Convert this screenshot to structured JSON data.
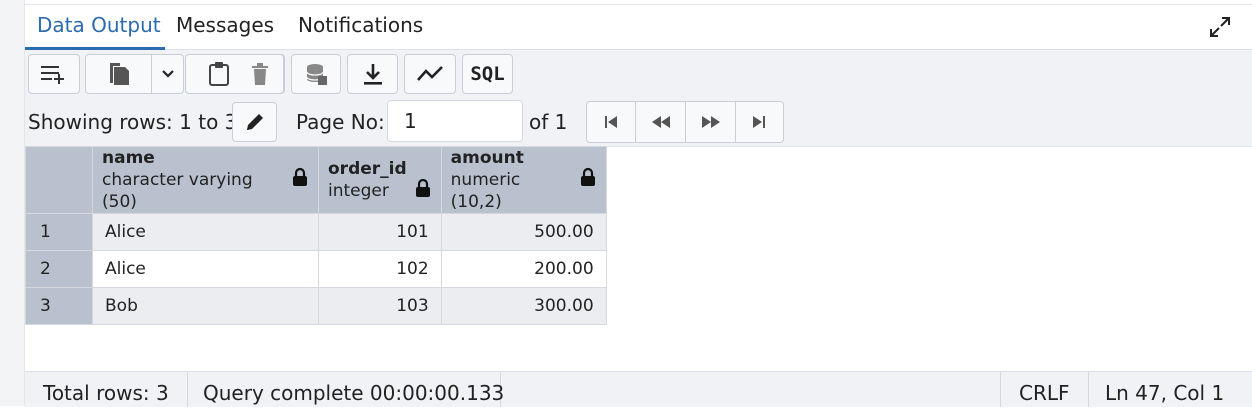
{
  "tabs": [
    {
      "label": "Data Output",
      "active": true
    },
    {
      "label": "Messages",
      "active": false
    },
    {
      "label": "Notifications",
      "active": false
    }
  ],
  "toolbar": {
    "buttons": [
      "add-row-icon",
      "copy-icon",
      "chevron-down-icon",
      "paste-icon",
      "chevron-down-icon",
      "delete-icon",
      "save-data-icon",
      "download-icon",
      "graph-icon"
    ],
    "sql_label": "SQL"
  },
  "pagination": {
    "showing_label": "Showing rows: 1 to 3",
    "page_label": "Page No:",
    "page_value": "1",
    "of_label": "of 1"
  },
  "grid": {
    "columns": [
      {
        "name": "name",
        "type": "character varying (50)"
      },
      {
        "name": "order_id",
        "type": "integer"
      },
      {
        "name": "amount",
        "type": "numeric (10,2)"
      }
    ],
    "rows": [
      {
        "num": "1",
        "name": "Alice",
        "order_id": "101",
        "amount": "500.00"
      },
      {
        "num": "2",
        "name": "Alice",
        "order_id": "102",
        "amount": "200.00"
      },
      {
        "num": "3",
        "name": "Bob",
        "order_id": "103",
        "amount": "300.00"
      }
    ]
  },
  "status": {
    "total_rows": "Total rows: 3",
    "query": "Query complete 00:00:00.133",
    "line_ending": "CRLF",
    "position": "Ln 47, Col 1"
  },
  "colors": {
    "accent": "#2b6bb0",
    "header_bg": "#b9c1cf",
    "toolbar_bg": "#f0f2f5"
  }
}
